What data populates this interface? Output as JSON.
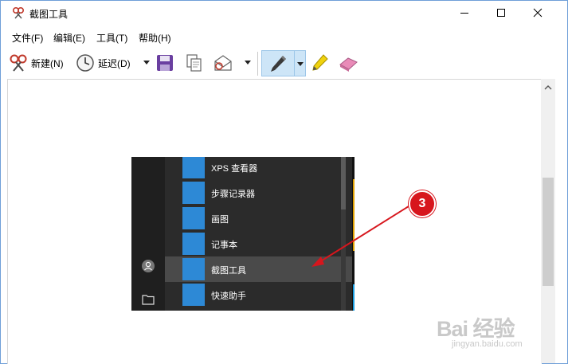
{
  "window": {
    "title": "截图工具"
  },
  "menu": [
    "文件(F)",
    "编辑(E)",
    "工具(T)",
    "帮助(H)"
  ],
  "toolbar": {
    "new_label": "新建(N)",
    "delay_label": "延迟(D)"
  },
  "start_menu": {
    "items": [
      {
        "label": "XPS 查看器",
        "icon": "xps-viewer-icon"
      },
      {
        "label": "步骤记录器",
        "icon": "steps-recorder-icon"
      },
      {
        "label": "画图",
        "icon": "paint-icon"
      },
      {
        "label": "记事本",
        "icon": "notepad-icon"
      },
      {
        "label": "截图工具",
        "icon": "snipping-tool-icon",
        "selected": true
      },
      {
        "label": "快速助手",
        "icon": "quick-assist-icon"
      }
    ]
  },
  "annotation": {
    "step_number": "3"
  },
  "colors": {
    "accent_red": "#d7161d",
    "start_bg": "#2b2b2b",
    "tile_blue": "#2d89d6"
  },
  "watermark": {
    "text": "Bai 经验",
    "url": "jingyan.baidu.com"
  }
}
